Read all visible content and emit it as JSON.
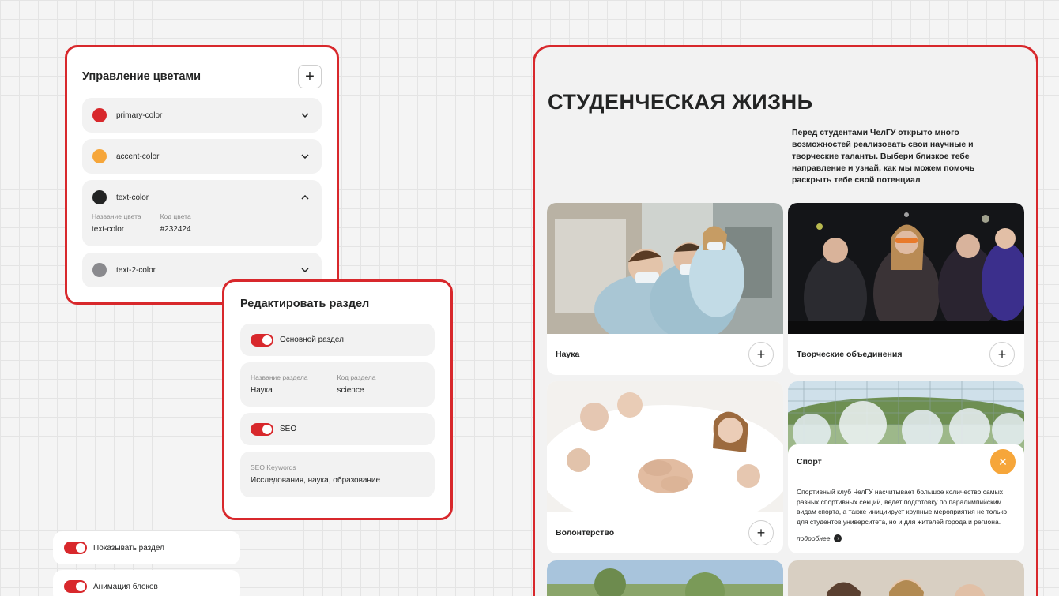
{
  "colors_panel": {
    "title": "Управление цветами",
    "add_symbol": "+",
    "items": [
      {
        "label": "primary-color",
        "color": "#d8282c"
      },
      {
        "label": "accent-color",
        "color": "#f6a63a"
      },
      {
        "label": "text-color",
        "color": "#232424",
        "expanded": true,
        "name_caption": "Название цвета",
        "name_value": "text-color",
        "code_caption": "Код цвета",
        "code_value": "#232424"
      },
      {
        "label": "text-2-color",
        "color": "#8a8a8e"
      }
    ]
  },
  "edit_panel": {
    "title": "Редактировать раздел",
    "main_section_toggle": "Основной раздел",
    "section_name_caption": "Название раздела",
    "section_name_value": "Наука",
    "section_code_caption": "Код раздела",
    "section_code_value": "science",
    "seo_toggle": "SEO",
    "seo_keywords_caption": "SEO Keywords",
    "seo_keywords_value": "Исследования, наука, образование"
  },
  "floating_toggles": {
    "show_section": "Показывать раздел",
    "animate_blocks": "Анимация блоков"
  },
  "student_life": {
    "title": "СТУДЕНЧЕСКАЯ ЖИЗНЬ",
    "description": "Перед студентами ЧелГУ открыто много возможностей реализовать свои научные и творческие таланты. Выбери близкое тебе направление и узнай, как мы можем помочь раскрыть тебе свой потенциал",
    "cards": {
      "science": "Наука",
      "creative": "Творческие объединения",
      "volunteer": "Волонтёрство",
      "sport": "Спорт"
    },
    "sport_text": "Спортивный клуб ЧелГУ насчитывает большое количество самых разных спортивных секций, ведет подготовку по паралимпийским видам спорта, а также инициирует крупные мероприятия не только для студентов университета, но и для жителей города и региона.",
    "more_link": "подробнее",
    "plus_symbol": "+",
    "close_symbol": "✕"
  },
  "theme": {
    "primary": "#d8282c",
    "accent": "#f6a63a",
    "text": "#232424"
  }
}
